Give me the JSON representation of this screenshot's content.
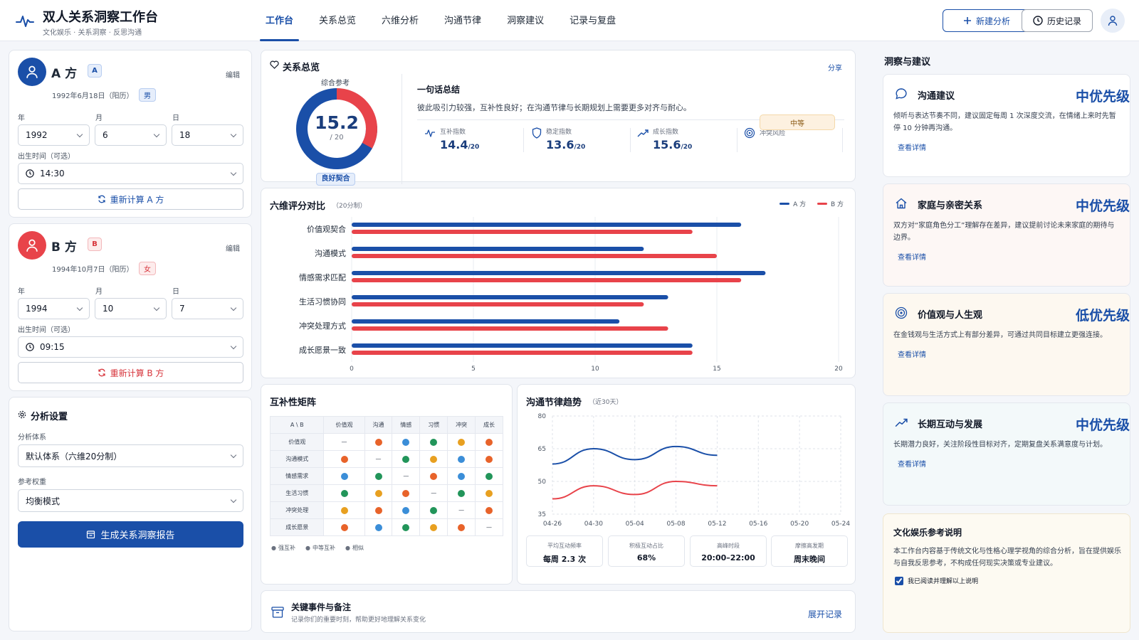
{
  "header": {
    "title": "双人关系洞察工作台",
    "subtitle": "文化娱乐 · 关系洞察 · 反思沟通",
    "tabs": [
      "工作台",
      "关系总览",
      "六维分析",
      "沟通节律",
      "洞察建议",
      "记录与复盘"
    ],
    "new_btn": "新建分析",
    "history_btn": "历史记录"
  },
  "person_a": {
    "name": "A 方",
    "badge": "A",
    "edit": "编辑",
    "birth": "1992年6月18日（阳历）",
    "gender": "男",
    "year_label": "年",
    "month_label": "月",
    "day_label": "日",
    "year": "1992",
    "month": "6",
    "day": "18",
    "time_label": "出生时间（可选）",
    "time": "14:30",
    "recalc": "重新计算 A 方"
  },
  "person_b": {
    "name": "B 方",
    "badge": "B",
    "edit": "编辑",
    "birth": "1994年10月7日（阳历）",
    "gender": "女",
    "year_label": "年",
    "month_label": "月",
    "day_label": "日",
    "year": "1994",
    "month": "10",
    "day": "7",
    "time_label": "出生时间（可选）",
    "time": "09:15",
    "recalc": "重新计算 B 方"
  },
  "settings": {
    "title": "分析设置",
    "system_label": "分析体系",
    "system": "默认体系（六维20分制）",
    "weight_label": "参考权重",
    "weight": "均衡模式",
    "generate": "生成关系洞察报告"
  },
  "overview": {
    "title": "关系总览",
    "share": "分享",
    "donut_label": "综合参考",
    "score": "15.2",
    "score_max": "/ 20",
    "score_value": 15.2,
    "score_total": 20,
    "tag": "良好契合",
    "summary_title": "一句话总结",
    "summary": "彼此吸引力较强，互补性良好；在沟通节律与长期规划上需要更多对齐与耐心。",
    "stats": [
      {
        "label": "互补指数",
        "value": "14.4",
        "unit": "/20"
      },
      {
        "label": "稳定指数",
        "value": "13.6",
        "unit": "/20"
      },
      {
        "label": "成长指数",
        "value": "15.6",
        "unit": "/20"
      }
    ],
    "risk_label": "冲突风险",
    "risk": "中等",
    "colors": {
      "a": "#1a4fa8",
      "b": "#e8434a"
    }
  },
  "six_dim": {
    "title": "六维评分对比",
    "subtitle": "（20分制）",
    "legend_a": "A 方",
    "legend_b": "B 方"
  },
  "chart_data": [
    {
      "type": "bar",
      "orientation": "horizontal",
      "categories": [
        "价值观契合",
        "沟通模式",
        "情感需求匹配",
        "生活习惯协同",
        "冲突处理方式",
        "成长愿景一致"
      ],
      "series": [
        {
          "name": "A 方",
          "values": [
            16,
            12,
            17,
            13,
            11,
            14
          ]
        },
        {
          "name": "B 方",
          "values": [
            14,
            15,
            16,
            12,
            13,
            14
          ]
        }
      ],
      "xlim": [
        0,
        20
      ],
      "xticks": [
        "0",
        "5",
        "10",
        "15",
        "20"
      ],
      "grid": true,
      "legend": "top-right"
    },
    {
      "type": "line",
      "x": [
        "04-26",
        "04-30",
        "05-04",
        "05-08",
        "05-12",
        "05-16",
        "05-20",
        "05-24"
      ],
      "ylim": [
        35,
        80
      ],
      "yticks": [
        "80",
        "65",
        "50",
        "35"
      ],
      "series": [
        {
          "values": [
            58,
            65,
            60,
            66,
            62
          ]
        },
        {
          "values": [
            42,
            48,
            44,
            50,
            48
          ]
        }
      ],
      "grid": true
    }
  ],
  "matrix": {
    "title": "互补性矩阵",
    "corner": "A \\ B",
    "columns": [
      "价值观",
      "沟通",
      "情感",
      "习惯",
      "冲突",
      "成长"
    ],
    "rows": [
      {
        "label": "价值观",
        "cells": [
          "-",
          "orange",
          "blue",
          "green",
          "yellow",
          "orange"
        ]
      },
      {
        "label": "沟通模式",
        "cells": [
          "orange",
          "-",
          "green",
          "yellow",
          "blue",
          "orange"
        ]
      },
      {
        "label": "情感需求",
        "cells": [
          "blue",
          "green",
          "-",
          "orange",
          "blue",
          "green"
        ]
      },
      {
        "label": "生活习惯",
        "cells": [
          "green",
          "yellow",
          "orange",
          "-",
          "green",
          "yellow"
        ]
      },
      {
        "label": "冲突处理",
        "cells": [
          "yellow",
          "orange",
          "blue",
          "green",
          "-",
          "orange"
        ]
      },
      {
        "label": "成长愿景",
        "cells": [
          "orange",
          "blue",
          "green",
          "yellow",
          "orange",
          "-"
        ]
      }
    ],
    "dash": "—",
    "dot_colors": {
      "orange": "#e8632a",
      "blue": "#3b8ed8",
      "green": "#22955a",
      "yellow": "#e8a020"
    },
    "legend": [
      "强互补",
      "中等互补",
      "相似"
    ]
  },
  "trend": {
    "title": "沟通节律趋势",
    "subtitle": "（近30天）",
    "stats": [
      {
        "label": "平均互动频率",
        "value": "每周 2.3 次"
      },
      {
        "label": "积极互动占比",
        "value": "68%"
      },
      {
        "label": "高峰时段",
        "value": "20:00–22:00"
      },
      {
        "label": "摩擦高发期",
        "value": "周末晚间"
      }
    ]
  },
  "events": {
    "title": "关键事件与备注",
    "subtitle": "记录你们的重要时刻，帮助更好地理解关系变化",
    "expand": "展开记录"
  },
  "insights": {
    "title": "洞察与建议",
    "cards": [
      {
        "title": "沟通建议",
        "priority": "中优先级",
        "desc": "倾听与表达节奏不同，建议固定每周 1 次深度交流，在情绪上来时先暂停 10 分钟再沟通。",
        "link": "查看详情",
        "bg": "#ffffff"
      },
      {
        "title": "家庭与亲密关系",
        "priority": "中优先级",
        "desc": "双方对“家庭角色分工”理解存在差异，建议提前讨论未来家庭的期待与边界。",
        "link": "查看详情",
        "bg": "#fdf7f5"
      },
      {
        "title": "价值观与人生观",
        "priority": "低优先级",
        "desc": "在金钱观与生活方式上有部分差异，可通过共同目标建立更强连接。",
        "link": "查看详情",
        "bg": "#fdf8f0"
      },
      {
        "title": "长期互动与发展",
        "priority": "中优先级",
        "desc": "长期潜力良好，关注阶段性目标对齐，定期复盘关系满意度与计划。",
        "link": "查看详情",
        "bg": "#f3f9fa"
      }
    ],
    "note_title": "文化娱乐参考说明",
    "note": "本工作台内容基于传统文化与性格心理学视角的综合分析，旨在提供娱乐与自我反思参考，不构成任何现实决策或专业建议。",
    "note_check": "我已阅读并理解以上说明"
  }
}
